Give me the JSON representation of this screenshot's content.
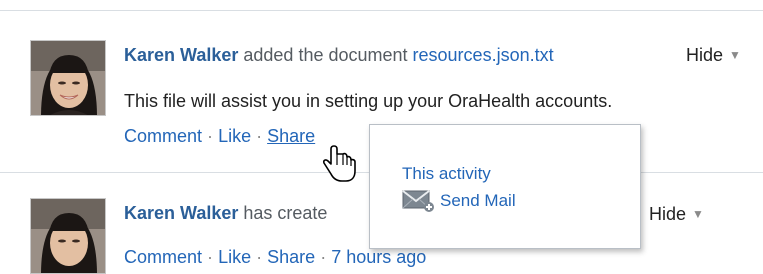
{
  "colors": {
    "link": "#2366b8",
    "author": "#2b5f99",
    "text": "#222222",
    "muted": "#555b61"
  },
  "posts": [
    {
      "author": "Karen Walker",
      "verb": " added the document ",
      "doc": "resources.json.txt",
      "hide": "Hide",
      "body": "This file will assist you in setting up your OraHealth accounts.",
      "actions": {
        "comment": "Comment",
        "like": "Like",
        "share": "Share"
      },
      "separator": "·"
    },
    {
      "author": "Karen Walker",
      "verb": " has create",
      "hide": "Hide",
      "actions": {
        "comment": "Comment",
        "like": "Like",
        "share": "Share",
        "time": "7 hours ago"
      },
      "separator": "·"
    }
  ],
  "popup": {
    "item1": "This activity",
    "item2": "Send Mail",
    "item2_icon": "send-mail-icon"
  },
  "cursor_icon": "hand-pointer-icon"
}
